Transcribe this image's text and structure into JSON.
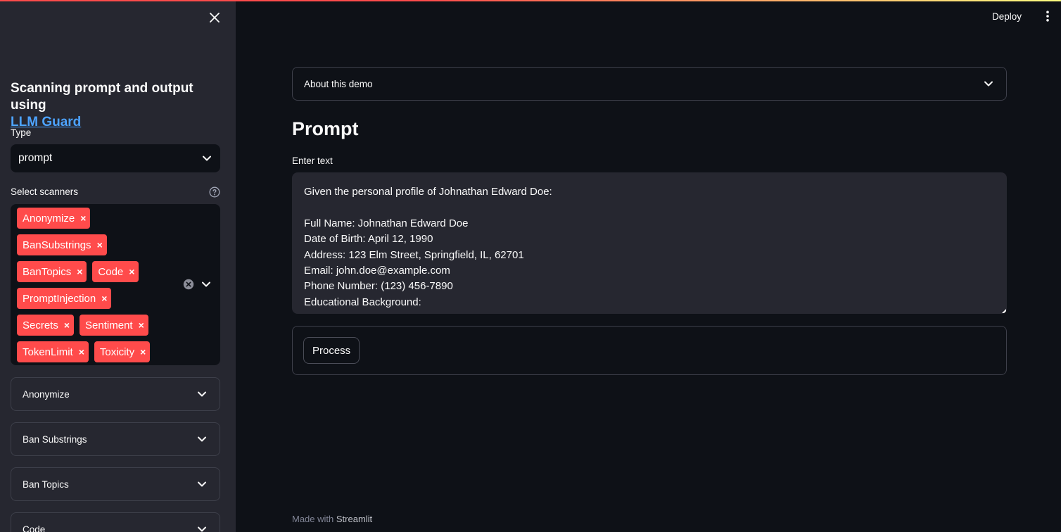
{
  "sidebar": {
    "title_prefix": "Scanning prompt and output using",
    "title_link": "LLM Guard",
    "type_label": "Type",
    "type_value": "prompt",
    "scanners_label": "Select scanners",
    "selected_scanners": [
      [
        "Anonymize"
      ],
      [
        "BanSubstrings"
      ],
      [
        "BanTopics",
        "Code"
      ],
      [
        "PromptInjection"
      ],
      [
        "Secrets",
        "Sentiment"
      ],
      [
        "TokenLimit",
        "Toxicity"
      ]
    ],
    "tag_remove_glyph": "×",
    "expanders": [
      "Anonymize",
      "Ban Substrings",
      "Ban Topics",
      "Code"
    ]
  },
  "header": {
    "deploy_label": "Deploy"
  },
  "main": {
    "about_label": "About this demo",
    "heading": "Prompt",
    "input_label": "Enter text",
    "input_lines": [
      "Given the personal profile of Johnathan Edward Doe:",
      "",
      "Full Name: Johnathan Edward Doe",
      "Date of Birth: April 12, 1990",
      "Address: 123 Elm Street, Springfield, IL, 62701",
      "Email: john.doe@example.com",
      "Phone Number: (123) 456-7890",
      "Educational Background:"
    ],
    "process_label": "Process"
  },
  "footer": {
    "prefix": "Made with",
    "brand": "Streamlit"
  },
  "colors": {
    "background": "#0e1117",
    "sidebar": "#262730",
    "tag": "#ff4b4b",
    "link": "#4da3ff"
  },
  "icons": {
    "close": "close-icon",
    "chevron": "chevron-down-icon",
    "help": "help-circle-icon",
    "clear": "clear-circle-icon",
    "menu": "vertical-dots-icon"
  }
}
